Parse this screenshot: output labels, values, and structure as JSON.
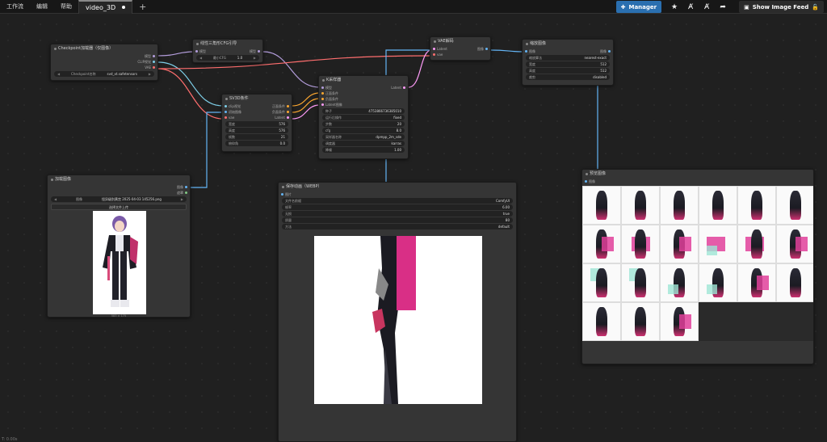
{
  "topbar": {
    "menu": [
      "工作流",
      "编辑",
      "帮助"
    ],
    "tab_name": "video_3D",
    "manager_label": "Manager",
    "feed_label": "Show Image Feed"
  },
  "nodes": {
    "checkpoint": {
      "title": "Checkpoint加载器（仅图像）",
      "outputs": [
        "模型",
        "CLIP视觉",
        "VAE"
      ],
      "widget_label": "Checkpoint名称",
      "widget_value": "svd_xt.safetensors"
    },
    "cfg": {
      "title": "线性三角形CFG引导",
      "input": "模型",
      "output": "模型",
      "widget_label": "最小CFG",
      "widget_value": "1.0"
    },
    "vae_decode": {
      "title": "VAE解码",
      "inputs": [
        "Latent",
        "vae"
      ],
      "output": "图像"
    },
    "preview_top": {
      "title": "缩放图像",
      "input": "图像",
      "output": "图像",
      "widgets": [
        {
          "label": "缩放算法",
          "value": "nearest-exact"
        },
        {
          "label": "宽度",
          "value": "512"
        },
        {
          "label": "高度",
          "value": "512"
        },
        {
          "label": "裁剪",
          "value": "disabled"
        }
      ]
    },
    "ksampler": {
      "title": "K采样器",
      "inputs": [
        "模型",
        "正面条件",
        "负面条件",
        "Latent图像"
      ],
      "output": "Latent",
      "widgets": [
        {
          "label": "种子",
          "value": "475386673638501​0"
        },
        {
          "label": "运行后操作",
          "value": "fixed"
        },
        {
          "label": "步数",
          "value": "20"
        },
        {
          "label": "cfg",
          "value": "8.0"
        },
        {
          "label": "采样器名称",
          "value": "dpmpp_2m_sde"
        },
        {
          "label": "调度器",
          "value": "karras"
        },
        {
          "label": "降噪",
          "value": "1.00"
        }
      ]
    },
    "sv3d": {
      "title": "SV3D条件",
      "inputs": [
        "clip视觉",
        "初始图像",
        "vae"
      ],
      "outputs": [
        "正面条件",
        "负面条件",
        "Latent"
      ],
      "widgets": [
        {
          "label": "宽度",
          "value": "576"
        },
        {
          "label": "高度",
          "value": "576"
        },
        {
          "label": "帧数",
          "value": "21"
        },
        {
          "label": "俯仰角",
          "value": "0.0"
        }
      ]
    },
    "load_image": {
      "title": "加载图像",
      "outputs": [
        "图像",
        "遮罩"
      ],
      "widget_label": "图像",
      "widget_value": "怪异级别黄宫 2025-04-03 145256.png",
      "button": "选择文件上传",
      "caption": "583 × 175"
    },
    "save_webp": {
      "title": "保存动画（WEBP）",
      "input": "图片",
      "widgets": [
        {
          "label": "文件名前缀",
          "value": "ComfyUI"
        },
        {
          "label": "帧率",
          "value": "6.00"
        },
        {
          "label": "无损",
          "value": "true"
        },
        {
          "label": "质量",
          "value": "80"
        },
        {
          "label": "方法",
          "value": "default"
        }
      ]
    },
    "preview_grid": {
      "title": "预览图像",
      "input": "图像"
    }
  },
  "footer": "T: 0.00s",
  "colors": {
    "model": "#b39ddb",
    "clip": "#7ecfe8",
    "vae": "#ff6e6e",
    "cond": "#ffa931",
    "latent": "#ff9cf9",
    "image": "#64b5f6"
  }
}
